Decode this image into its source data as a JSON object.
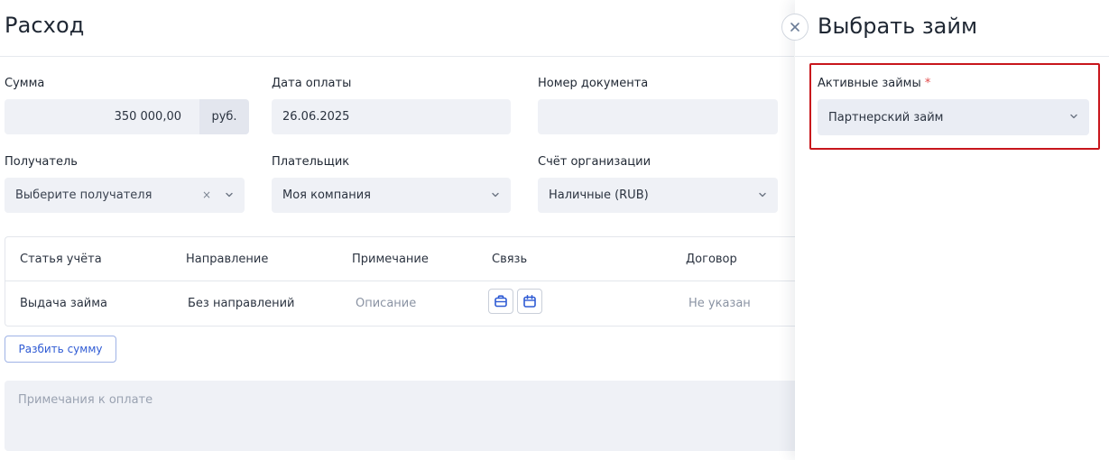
{
  "form": {
    "title": "Расход",
    "amount": {
      "label": "Сумма",
      "value": "350 000,00",
      "unit": "руб."
    },
    "payment_date": {
      "label": "Дата оплаты",
      "value": "26.06.2025"
    },
    "doc_number": {
      "label": "Номер документа",
      "value": ""
    },
    "recipient": {
      "label": "Получатель",
      "placeholder": "Выберите получателя",
      "clear": "×"
    },
    "payer": {
      "label": "Плательщик",
      "value": "Моя компания"
    },
    "account": {
      "label": "Счёт организации",
      "value": "Наличные (RUB)"
    },
    "table": {
      "headers": [
        "Статья учёта",
        "Направление",
        "Примечание",
        "Связь",
        "Договор"
      ],
      "row": {
        "article": "Выдача займа",
        "direction": "Без направлений",
        "note": "Описание",
        "contract": "Не указан"
      }
    },
    "split_button": "Разбить сумму",
    "notes_placeholder": "Примечания к оплате"
  },
  "panel": {
    "title": "Выбрать займ",
    "loans": {
      "label": "Активные займы",
      "required_mark": "*",
      "value": "Партнерский займ"
    }
  },
  "colors": {
    "accent": "#2f5bd4",
    "highlight": "#c8161c",
    "field_bg": "#eff1f6"
  },
  "icons": [
    "close-icon",
    "chevron-down-icon",
    "clear-icon",
    "briefcase-icon",
    "calendar-icon"
  ]
}
